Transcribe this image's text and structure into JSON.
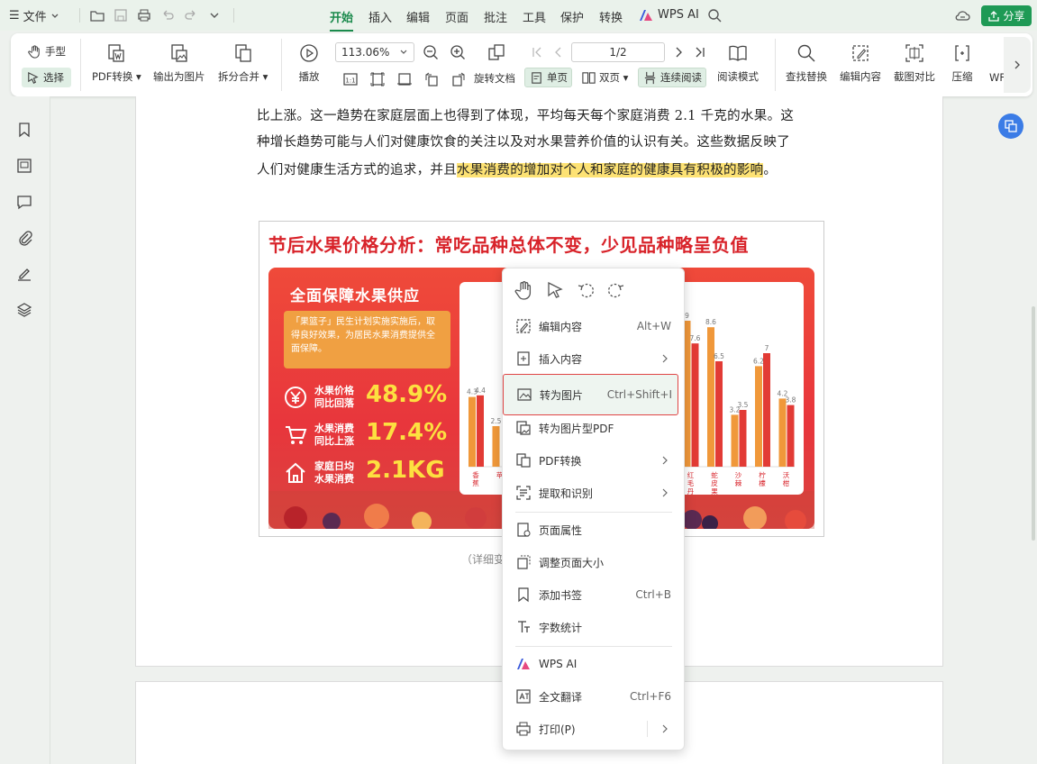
{
  "menubar": {
    "file": "文件",
    "tabs": [
      "开始",
      "插入",
      "编辑",
      "页面",
      "批注",
      "工具",
      "保护",
      "转换"
    ],
    "active_tab": "开始",
    "wps_ai": "WPS AI",
    "share": "分享"
  },
  "ribbon": {
    "hand": "手型",
    "select": "选择",
    "pdf_convert": "PDF转换",
    "export_image": "输出为图片",
    "split_merge": "拆分合并",
    "play": "播放",
    "zoom": "113.06%",
    "page": "1/2",
    "rotate": "旋转文档",
    "single": "单页",
    "double": "双页",
    "continuous": "连续阅读",
    "read_mode": "阅读模式",
    "find_replace": "查找替换",
    "edit_content": "编辑内容",
    "screenshot_compare": "截图对比",
    "compress": "压缩",
    "more": "WF"
  },
  "document": {
    "line1": "比上涨。这一趋势在家庭层面上也得到了体现，平均每天每个家庭消费 2.1 千克的水果。这",
    "line2": "种增长趋势可能与人们对健康饮食的关注以及对水果营养价值的认识有关。这些数据反映了",
    "line3_pre": "人们对健康生活方式的追求，并且",
    "line3_hl": "水果消费的增加对个人和家庭的健康具有积极的影响",
    "line3_post": "。",
    "caption": "（详细变",
    "infographic": {
      "title": "节后水果价格分析：常吃品种总体不变，少见品种略呈负值",
      "supply_title": "全面保障水果供应",
      "supply_text": "「果篮子」民生计划实施实施后，取得良好效果，为居民水果消费提供全面保障。",
      "stats": [
        {
          "label": "水果价格\n同比回落",
          "value": "48.9%"
        },
        {
          "label": "水果消费\n同比上涨",
          "value": "17.4%"
        },
        {
          "label": "家庭日均\n水果消费",
          "value": "2.1KG"
        }
      ]
    }
  },
  "chart_data": {
    "type": "bar",
    "categories": [
      "香蕉",
      "苹",
      "",
      "",
      "",
      "",
      "",
      "",
      "",
      "红毛丹",
      "蛇皮果",
      "沙棘",
      "柠檬",
      "沃柑"
    ],
    "series": [
      {
        "values": [
          4.3,
          2.5,
          null,
          null,
          null,
          null,
          null,
          null,
          null,
          9,
          8.6,
          3.2,
          6.2,
          4.2
        ]
      },
      {
        "values": [
          4.4,
          null,
          null,
          null,
          null,
          null,
          null,
          null,
          null,
          7.6,
          6.5,
          3.5,
          7,
          3.8
        ]
      }
    ],
    "colors": [
      "#f0983a",
      "#e23b35"
    ],
    "ylim": [
      0,
      10
    ]
  },
  "context_menu": {
    "items": [
      {
        "label": "编辑内容",
        "shortcut": "Alt+W"
      },
      {
        "label": "插入内容",
        "shortcut": ""
      },
      {
        "label": "转为图片",
        "shortcut": "Ctrl+Shift+I"
      },
      {
        "label": "转为图片型PDF",
        "shortcut": ""
      },
      {
        "label": "PDF转换",
        "shortcut": ""
      },
      {
        "label": "提取和识别",
        "shortcut": ""
      },
      {
        "label": "页面属性",
        "shortcut": ""
      },
      {
        "label": "调整页面大小",
        "shortcut": ""
      },
      {
        "label": "添加书签",
        "shortcut": "Ctrl+B"
      },
      {
        "label": "字数统计",
        "shortcut": ""
      },
      {
        "label": "WPS AI",
        "shortcut": ""
      },
      {
        "label": "全文翻译",
        "shortcut": "Ctrl+F6"
      },
      {
        "label": "打印(P)",
        "shortcut": ""
      }
    ]
  }
}
